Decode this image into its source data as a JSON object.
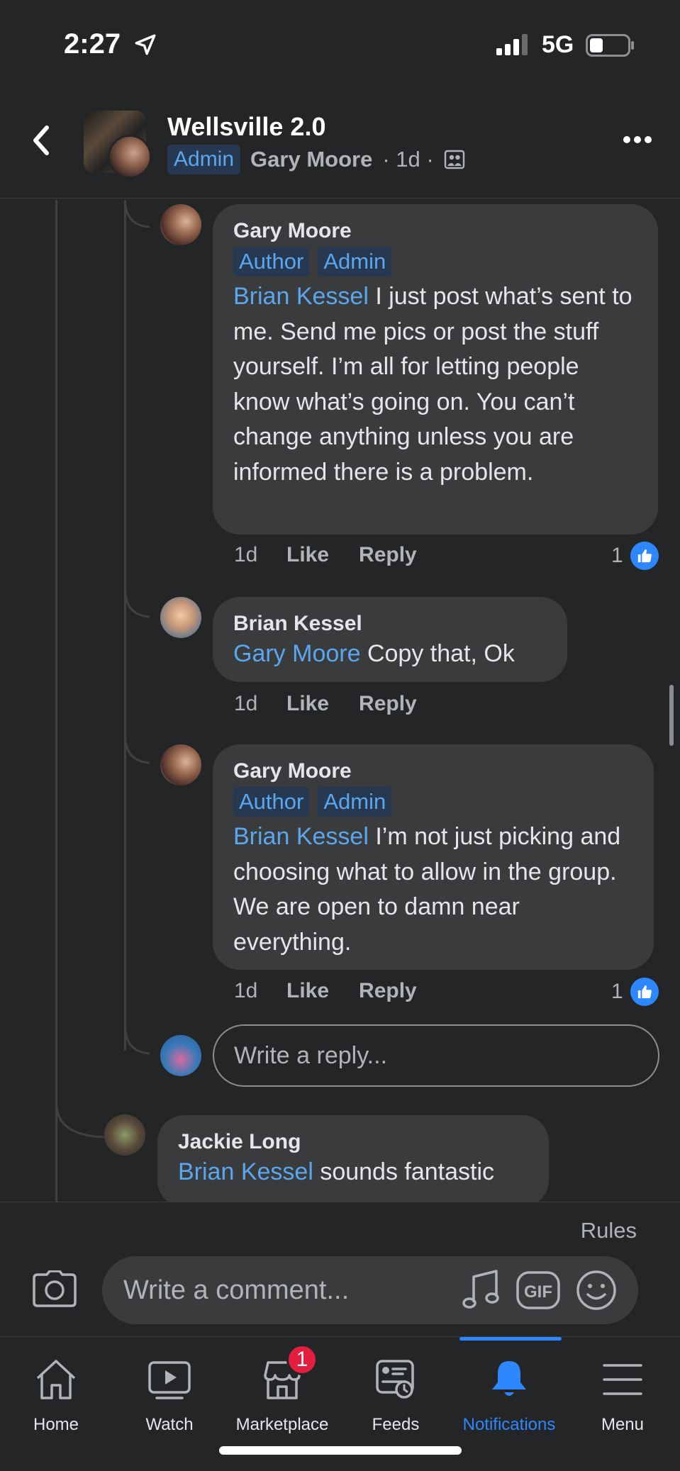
{
  "status_bar": {
    "time": "2:27",
    "network": "5G"
  },
  "header": {
    "group_name": "Wellsville 2.0",
    "admin_badge": "Admin",
    "author": "Gary Moore",
    "age": "· 1d ·",
    "icons": {
      "back": "chevron-left-icon",
      "privacy": "group-members-icon",
      "more": "more-dots-icon"
    }
  },
  "comments": [
    {
      "name": "Gary Moore",
      "badges": [
        "Author",
        "Admin"
      ],
      "mention": "Brian Kessel",
      "text": " I just post what’s sent to me. Send me pics or post the stuff yourself. I’m all for letting people know what’s going on. You can’t change anything unless you are informed there is a problem.",
      "time": "1d",
      "like": "Like",
      "reply": "Reply",
      "reactions": "1"
    },
    {
      "name": "Brian Kessel",
      "mention": "Gary Moore",
      "text": " Copy that, Ok",
      "time": "1d",
      "like": "Like",
      "reply": "Reply"
    },
    {
      "name": "Gary Moore",
      "badges": [
        "Author",
        "Admin"
      ],
      "mention": "Brian Kessel",
      "text": " I’m not just picking and choosing what to allow in the group. We are open to damn near everything.",
      "time": "1d",
      "like": "Like",
      "reply": "Reply",
      "reactions": "1"
    },
    {
      "name": "Jackie Long",
      "mention": "Brian Kessel",
      "text": " sounds fantastic"
    }
  ],
  "reply_input": {
    "placeholder": "Write a reply..."
  },
  "composer": {
    "rules": "Rules",
    "placeholder": "Write a comment...",
    "icons": [
      "camera-icon",
      "music-note-icon",
      "gif-icon",
      "emoji-icon"
    ]
  },
  "tabs": [
    {
      "label": "Home",
      "icon": "home-icon"
    },
    {
      "label": "Watch",
      "icon": "watch-icon"
    },
    {
      "label": "Marketplace",
      "icon": "marketplace-icon",
      "badge": "1"
    },
    {
      "label": "Feeds",
      "icon": "feeds-icon"
    },
    {
      "label": "Notifications",
      "icon": "bell-icon",
      "active": true
    },
    {
      "label": "Menu",
      "icon": "menu-icon"
    }
  ],
  "colors": {
    "background": "#242526",
    "bubble": "#3a3b3c",
    "accent": "#2d88ff",
    "mention": "#5aa7f0",
    "badge_bg": "#263951"
  }
}
